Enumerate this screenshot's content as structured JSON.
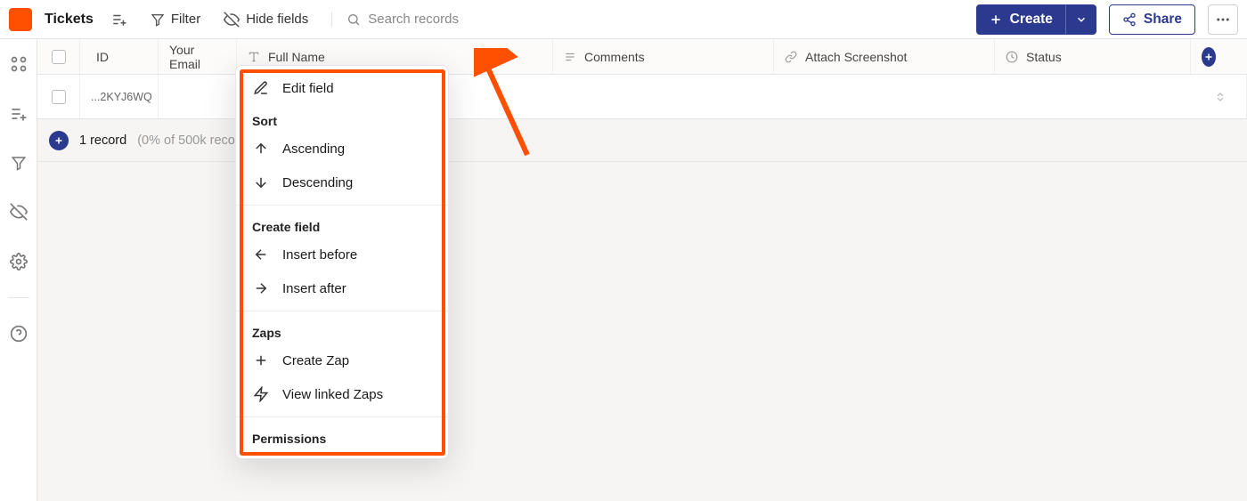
{
  "topbar": {
    "title": "Tickets",
    "filter": "Filter",
    "hide_fields": "Hide fields",
    "search_placeholder": "Search records",
    "create": "Create",
    "share": "Share"
  },
  "columns": {
    "id": "ID",
    "email": "Your Email",
    "full_name": "Full Name",
    "comments": "Comments",
    "screenshot": "Attach Screenshot",
    "status": "Status"
  },
  "row": {
    "id": "...2KYJ6WQ"
  },
  "footer": {
    "record_count": "1 record",
    "limit_note": "(0% of 500k records)"
  },
  "context_menu": {
    "edit_field": "Edit field",
    "sort_header": "Sort",
    "ascending": "Ascending",
    "descending": "Descending",
    "create_field_header": "Create field",
    "insert_before": "Insert before",
    "insert_after": "Insert after",
    "zaps_header": "Zaps",
    "create_zap": "Create Zap",
    "view_linked_zaps": "View linked Zaps",
    "permissions": "Permissions"
  }
}
